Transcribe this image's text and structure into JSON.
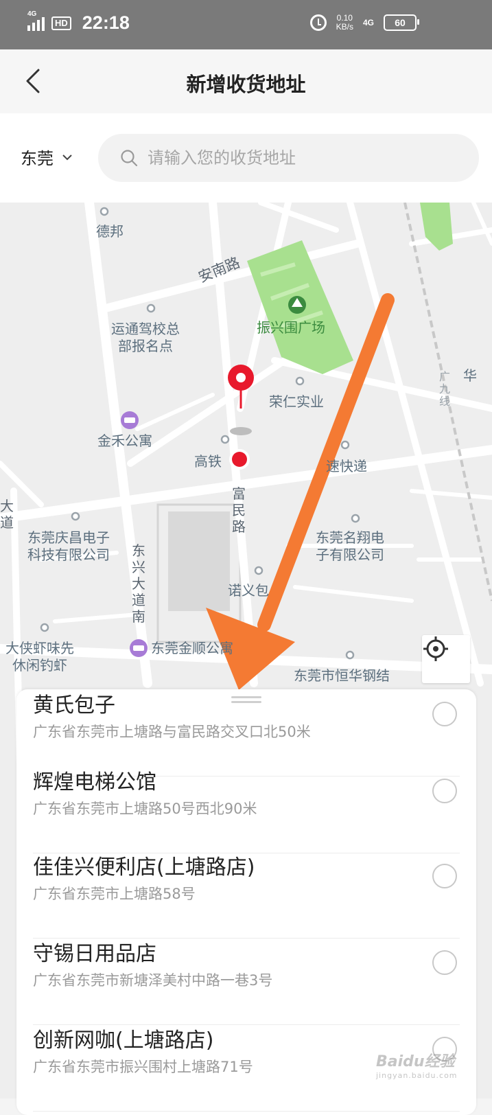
{
  "status_bar": {
    "network": "4G",
    "hd": "HD",
    "time": "22:18",
    "speed_value": "0.10",
    "speed_unit": "KB/s",
    "network2": "4G",
    "battery": "60"
  },
  "header": {
    "title": "新增收货地址"
  },
  "search": {
    "city": "东莞",
    "placeholder": "请输入您的收货地址"
  },
  "map": {
    "labels": {
      "debang": "德邦",
      "annan_road": "安南路",
      "yuntong": "运通驾校总\n部报名点",
      "zhenxingwei": "振兴围广场",
      "rongren": "荣仁实业",
      "hua": "华",
      "guang_line": "广\n九\n线",
      "jinhe": "金禾公寓",
      "gaotie": "高铁",
      "express": "速快递",
      "fumin_road": "富\n民\n路",
      "dongxing_ave_left": "大\n道",
      "qingchang": "东莞庆昌电子\n科技有限公司",
      "dongxing_ave": "东\n兴\n大\n道\n南",
      "mingxiang": "东莞名翔电\n子有限公司",
      "nuoyi": "诺义包",
      "daxia": "大侠虾味先\n休闲钓虾",
      "jinshun": "东莞金顺公寓",
      "steel": "东莞市恒华钢结"
    }
  },
  "places": [
    {
      "name": "黄氏包子",
      "address": "广东省东莞市上塘路与富民路交叉口北50米"
    },
    {
      "name": "辉煌电梯公馆",
      "address": "广东省东莞市上塘路50号西北90米"
    },
    {
      "name": "佳佳兴便利店(上塘路店)",
      "address": "广东省东莞市上塘路58号"
    },
    {
      "name": "守锡日用品店",
      "address": "广东省东莞市新塘泽美村中路一巷3号"
    },
    {
      "name": "创新网咖(上塘路店)",
      "address": "广东省东莞市振兴围村上塘路71号"
    }
  ],
  "watermark": {
    "brand": "Baidu经验",
    "url": "jingyan.baidu.com"
  },
  "colors": {
    "pin": "#e8192c",
    "arrow": "#f47a33",
    "park": "#a8e08f",
    "accent_park_text": "#3b8b3f"
  }
}
